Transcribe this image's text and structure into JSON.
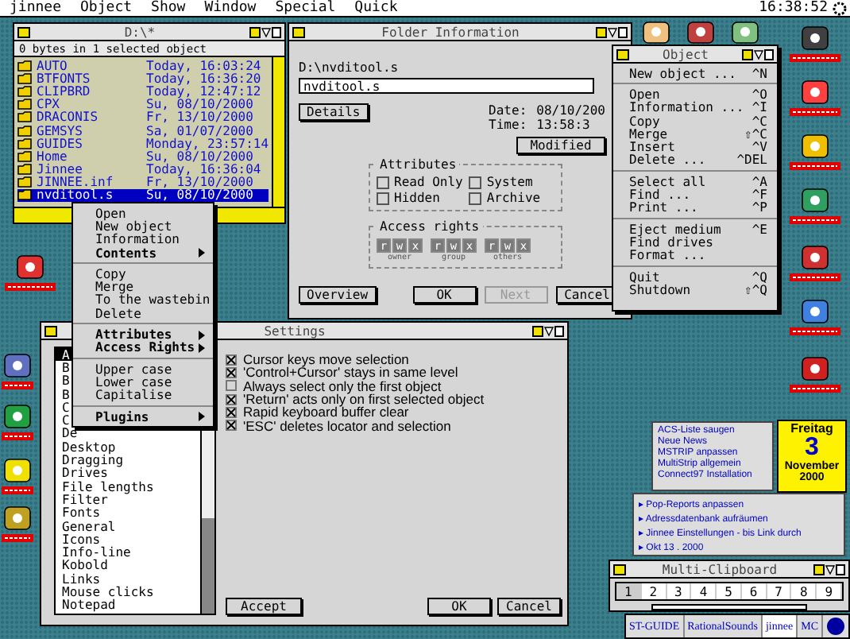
{
  "menu_bar": {
    "items": [
      "jinnee",
      "Object",
      "Show",
      "Window",
      "Special",
      "Quick"
    ],
    "clock": "16:38:52"
  },
  "file_window": {
    "title": "D:\\*",
    "info": "0 bytes in 1 selected object",
    "rows": [
      {
        "name": "AUTO",
        "date": "Today, 16:03:24",
        "selected": false
      },
      {
        "name": "BTFONTS",
        "date": "Today, 16:36:20",
        "selected": false
      },
      {
        "name": "CLIPBRD",
        "date": "Today, 12:47:12",
        "selected": false
      },
      {
        "name": "CPX",
        "date": "Su, 08/10/2000",
        "selected": false
      },
      {
        "name": "DRACONIS",
        "date": "Fr, 13/10/2000",
        "selected": false
      },
      {
        "name": "GEMSYS",
        "date": "Sa, 01/07/2000",
        "selected": false
      },
      {
        "name": "GUIDES",
        "date": "Monday, 23:57:14",
        "selected": false
      },
      {
        "name": "Home",
        "date": "Su, 08/10/2000",
        "selected": false
      },
      {
        "name": "Jinnee",
        "date": "Today, 16:36:04",
        "selected": false
      },
      {
        "name": "JINNEE.inf",
        "date": "Fr, 13/10/2000",
        "selected": false
      },
      {
        "name": "nvditool.s",
        "date": "Su, 08/10/2000",
        "selected": true
      }
    ]
  },
  "context_menu": {
    "groups": [
      [
        {
          "label": "Open",
          "submenu": false
        },
        {
          "label": "New object",
          "submenu": false
        },
        {
          "label": "Information",
          "submenu": false
        },
        {
          "label": "Contents",
          "submenu": true
        }
      ],
      [
        {
          "label": "Copy",
          "submenu": false
        },
        {
          "label": "Merge",
          "submenu": false
        },
        {
          "label": "To the wastebin",
          "submenu": false
        },
        {
          "label": "Delete",
          "submenu": false
        }
      ],
      [
        {
          "label": "Attributes",
          "submenu": true
        },
        {
          "label": "Access Rights",
          "submenu": true
        }
      ],
      [
        {
          "label": "Upper case",
          "submenu": false
        },
        {
          "label": "Lower case",
          "submenu": false
        },
        {
          "label": "Capitalise",
          "submenu": false
        }
      ],
      [
        {
          "label": "Plugins",
          "submenu": true
        }
      ]
    ]
  },
  "folder_info": {
    "title": "Folder Information",
    "path": "D:\\nvditool.s",
    "name_value": "nvditool.s",
    "details": "Details",
    "date_label": "Date:",
    "date": "08/10/200",
    "time_label": "Time:",
    "time": "13:58:3",
    "modified": "Modified",
    "attributes": {
      "title": "Attributes",
      "items": [
        {
          "label": "Read Only",
          "checked": false
        },
        {
          "label": "System",
          "checked": false
        },
        {
          "label": "Hidden",
          "checked": false
        },
        {
          "label": "Archive",
          "checked": false
        }
      ]
    },
    "access": {
      "title": "Access rights",
      "groups": [
        {
          "label": "owner",
          "bits": [
            {
              "label": "r",
              "on": true
            },
            {
              "label": "w",
              "on": true
            },
            {
              "label": "x",
              "on": true
            }
          ]
        },
        {
          "label": "group",
          "bits": [
            {
              "label": "r",
              "on": true
            },
            {
              "label": "w",
              "on": true
            },
            {
              "label": "x",
              "on": true
            }
          ]
        },
        {
          "label": "others",
          "bits": [
            {
              "label": "r",
              "on": true
            },
            {
              "label": "w",
              "on": true
            },
            {
              "label": "x",
              "on": true
            }
          ]
        }
      ]
    },
    "buttons": [
      {
        "label": "Overview",
        "disabled": false
      },
      {
        "label": "OK",
        "disabled": false
      },
      {
        "label": "Next",
        "disabled": true
      },
      {
        "label": "Cancel",
        "disabled": false
      }
    ]
  },
  "object_menu": {
    "title": "Object",
    "groups": [
      [
        {
          "label": "New object ...",
          "shortcut": "^N"
        }
      ],
      [
        {
          "label": "Open",
          "shortcut": "^O"
        },
        {
          "label": "Information ...",
          "shortcut": "^I"
        },
        {
          "label": "Copy",
          "shortcut": "^C"
        },
        {
          "label": "Merge",
          "shortcut": "⇧^C"
        },
        {
          "label": "Insert",
          "shortcut": "^V"
        },
        {
          "label": "Delete ...",
          "shortcut": "^DEL"
        }
      ],
      [
        {
          "label": "Select all",
          "shortcut": "^A"
        },
        {
          "label": "Find ...",
          "shortcut": "^F"
        },
        {
          "label": "Print ...",
          "shortcut": "^P"
        }
      ],
      [
        {
          "label": "Eject medium",
          "shortcut": "^E"
        },
        {
          "label": "Find drives"
        },
        {
          "label": "Format ..."
        }
      ],
      [
        {
          "label": "Quit",
          "shortcut": "^Q"
        },
        {
          "label": "Shutdown",
          "shortcut": "⇧^Q"
        }
      ]
    ]
  },
  "settings": {
    "title": "Settings",
    "categories": [
      {
        "label": "A",
        "selected": true
      },
      {
        "label": "B",
        "selected": false
      },
      {
        "label": "B",
        "selected": false
      },
      {
        "label": "B",
        "selected": false
      },
      {
        "label": "C",
        "selected": false
      },
      {
        "label": "C",
        "selected": false
      },
      {
        "label": "De",
        "selected": false
      },
      {
        "label": "Desktop",
        "selected": false
      },
      {
        "label": "Dragging",
        "selected": false
      },
      {
        "label": "Drives",
        "selected": false
      },
      {
        "label": "File lengths",
        "selected": false
      },
      {
        "label": "Filter",
        "selected": false
      },
      {
        "label": "Fonts",
        "selected": false
      },
      {
        "label": "General",
        "selected": false
      },
      {
        "label": "Icons",
        "selected": false
      },
      {
        "label": "Info-line",
        "selected": false
      },
      {
        "label": "Kobold",
        "selected": false
      },
      {
        "label": "Links",
        "selected": false
      },
      {
        "label": "Mouse clicks",
        "selected": false
      },
      {
        "label": "Notepad",
        "selected": false
      }
    ],
    "options": [
      {
        "label": "Cursor keys move selection",
        "checked": true
      },
      {
        "label": "'Control+Cursor' stays in same level",
        "checked": true
      },
      {
        "label": "Always select only the first object",
        "checked": false
      },
      {
        "label": "'Return' acts only on first selected object",
        "checked": true
      },
      {
        "label": "Rapid keyboard buffer clear",
        "checked": true
      },
      {
        "label": "'ESC' deletes locator and selection",
        "checked": true
      }
    ],
    "buttons": [
      "Accept",
      "OK",
      "Cancel"
    ]
  },
  "calendar": {
    "weekday": "Freitag",
    "day": "3",
    "month": "November",
    "year": "2000"
  },
  "notes": [
    {
      "lines": [
        "ACS-Liste saugen",
        "Neue News",
        "MSTRIP anpassen",
        "MultiStrip allgemein",
        "Connect97 Installation"
      ]
    },
    {
      "lines": [
        "▸ Pop-Reports anpassen",
        "▸ Adressdatenbank aufräumen",
        "▸ Jinnee Einstellungen - bis Link durch",
        "▸ Okt 13 . 2000"
      ]
    }
  ],
  "clipboard": {
    "title": "Multi-Clipboard",
    "slots": [
      {
        "label": "1",
        "selected": true
      },
      {
        "label": "2",
        "selected": false
      },
      {
        "label": "3",
        "selected": false
      },
      {
        "label": "4",
        "selected": false
      },
      {
        "label": "5",
        "selected": false
      },
      {
        "label": "6",
        "selected": false
      },
      {
        "label": "7",
        "selected": false
      },
      {
        "label": "8",
        "selected": false
      },
      {
        "label": "9",
        "selected": false
      }
    ]
  },
  "taskbar": {
    "items": [
      {
        "label": "ST-GUIDE",
        "active": false
      },
      {
        "label": "RationalSounds",
        "active": false
      },
      {
        "label": "jinnee",
        "active": true
      },
      {
        "label": "MC",
        "active": false
      }
    ]
  }
}
